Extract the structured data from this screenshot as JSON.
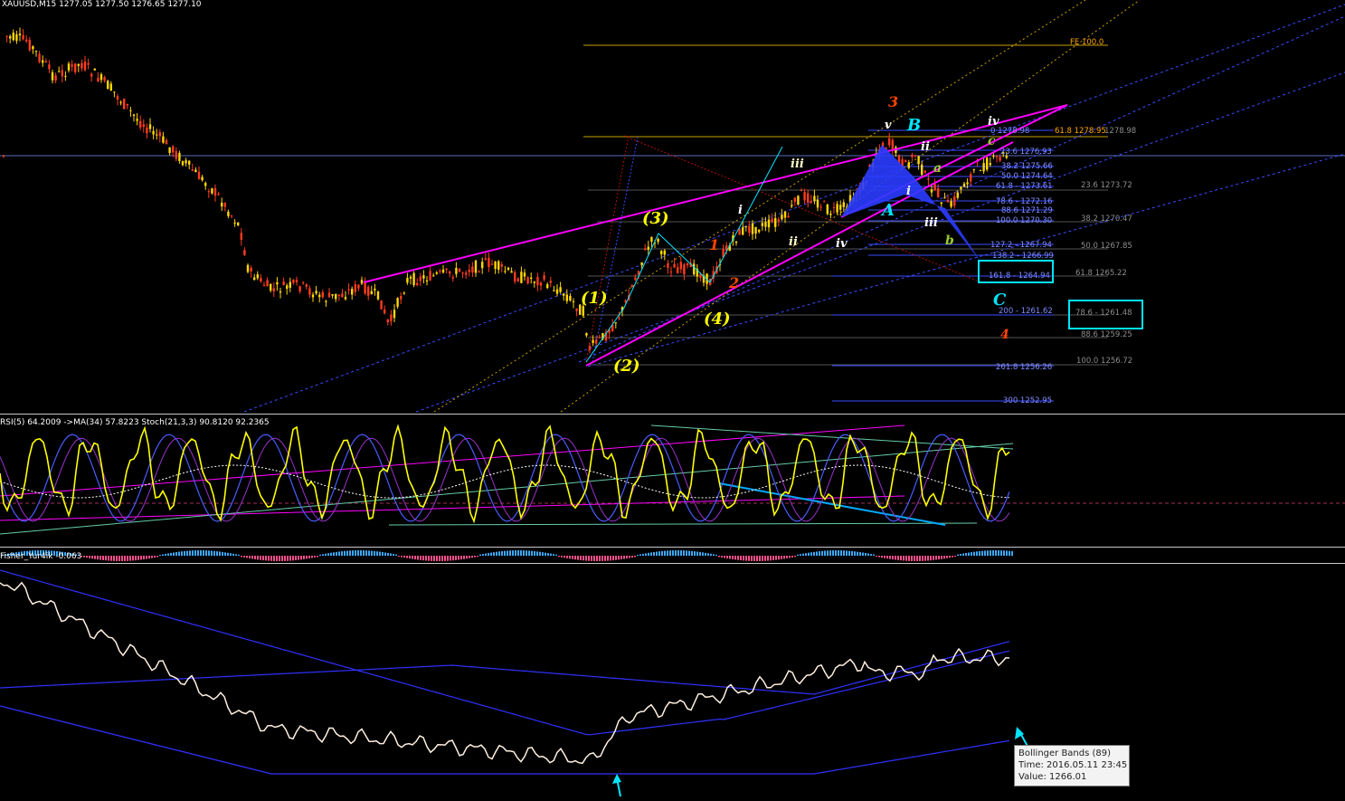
{
  "header": {
    "main": "XAUUSD,M15  1277.05 1277.50 1276.65 1277.10",
    "sub1": "RSI(5) 64.2009  ->MA(34) 57.8223  Stoch(21,3,3) 90.8120 92.2365",
    "sub2": "Fisher_Yur4ik -0.063"
  },
  "fib_labels": [
    {
      "text": "FE 100.0",
      "color": "#ffa500"
    },
    {
      "text": "0 1278.98",
      "color": "#7f8cff"
    },
    {
      "text": "61.8 1278.95",
      "color": "#ffa500"
    },
    {
      "text": "1278.98",
      "color": "#8c8c8c"
    },
    {
      "text": "23.6 1276.93",
      "color": "#7f8cff"
    },
    {
      "text": "38.2 1275.66",
      "color": "#7f8cff"
    },
    {
      "text": "50.0 1274.64",
      "color": "#7f8cff"
    },
    {
      "text": "61.8 - 1273.61",
      "color": "#7f8cff"
    },
    {
      "text": "23.6 1273.72",
      "color": "#8c8c8c"
    },
    {
      "text": "78.6 - 1272.16",
      "color": "#7f8cff"
    },
    {
      "text": "88.6 1271.29",
      "color": "#7f8cff"
    },
    {
      "text": "100.0 1270.30",
      "color": "#7f8cff"
    },
    {
      "text": "38.2 1270.47",
      "color": "#8c8c8c"
    },
    {
      "text": "127.2 - 1267.94",
      "color": "#7f8cff"
    },
    {
      "text": "50.0 1267.85",
      "color": "#8c8c8c"
    },
    {
      "text": "138.2 - 1266.99",
      "color": "#7f8cff"
    },
    {
      "text": "161.8 - 1264.94",
      "color": "#7f8cff"
    },
    {
      "text": "61.8 1265.22",
      "color": "#8c8c8c"
    },
    {
      "text": "200 - 1261.62",
      "color": "#7f8cff"
    },
    {
      "text": "78.6 - 1261.48",
      "color": "#8c8c8c"
    },
    {
      "text": "88.6 1259.25",
      "color": "#8c8c8c"
    },
    {
      "text": "261.8 1256.26",
      "color": "#7f8cff"
    },
    {
      "text": "100.0 1256.72",
      "color": "#8c8c8c"
    },
    {
      "text": "300 1252.95",
      "color": "#7f8cff"
    }
  ],
  "wave_labels": [
    {
      "text": "(1)",
      "color": "#ffff00"
    },
    {
      "text": "(2)",
      "color": "#ffff00"
    },
    {
      "text": "(3)",
      "color": "#ffff00"
    },
    {
      "text": "(4)",
      "color": "#ffff00"
    },
    {
      "text": "1",
      "color": "#ff4500"
    },
    {
      "text": "2",
      "color": "#ff4500"
    },
    {
      "text": "3",
      "color": "#ff4500"
    },
    {
      "text": "4",
      "color": "#ff4500"
    },
    {
      "text": "i",
      "color": "#ffffff"
    },
    {
      "text": "ii",
      "color": "#ffffcc"
    },
    {
      "text": "iii",
      "color": "#ffffcc"
    },
    {
      "text": "iv",
      "color": "#ffffff"
    },
    {
      "text": "v",
      "color": "#ffffff"
    },
    {
      "text": "i",
      "color": "#ffffff"
    },
    {
      "text": "ii",
      "color": "#ffffff"
    },
    {
      "text": "iii",
      "color": "#ffffff"
    },
    {
      "text": "iv",
      "color": "#ffffff"
    },
    {
      "text": "a",
      "color": "#9acd32"
    },
    {
      "text": "b",
      "color": "#9acd32"
    },
    {
      "text": "c",
      "color": "#9acd32"
    },
    {
      "text": "A",
      "color": "#00e5ff"
    },
    {
      "text": "B",
      "color": "#00e5ff"
    },
    {
      "text": "C",
      "color": "#00e5ff"
    }
  ],
  "tooltip": {
    "title": "Bollinger Bands (89)",
    "time": "Time: 2016.05.11 23:45",
    "value": "Value: 1266.01"
  },
  "colors": {
    "background": "#000000",
    "bull_candle": "#ffd700",
    "bear_candle": "#ff3b1f",
    "trendline": "#ff00ff",
    "rsi_line": "#ffff00",
    "stoch_line": "#4a5bff",
    "fisher_line": "#fff0e0",
    "bollinger": "#3030ff",
    "highlight_box": "#00e5ff"
  }
}
